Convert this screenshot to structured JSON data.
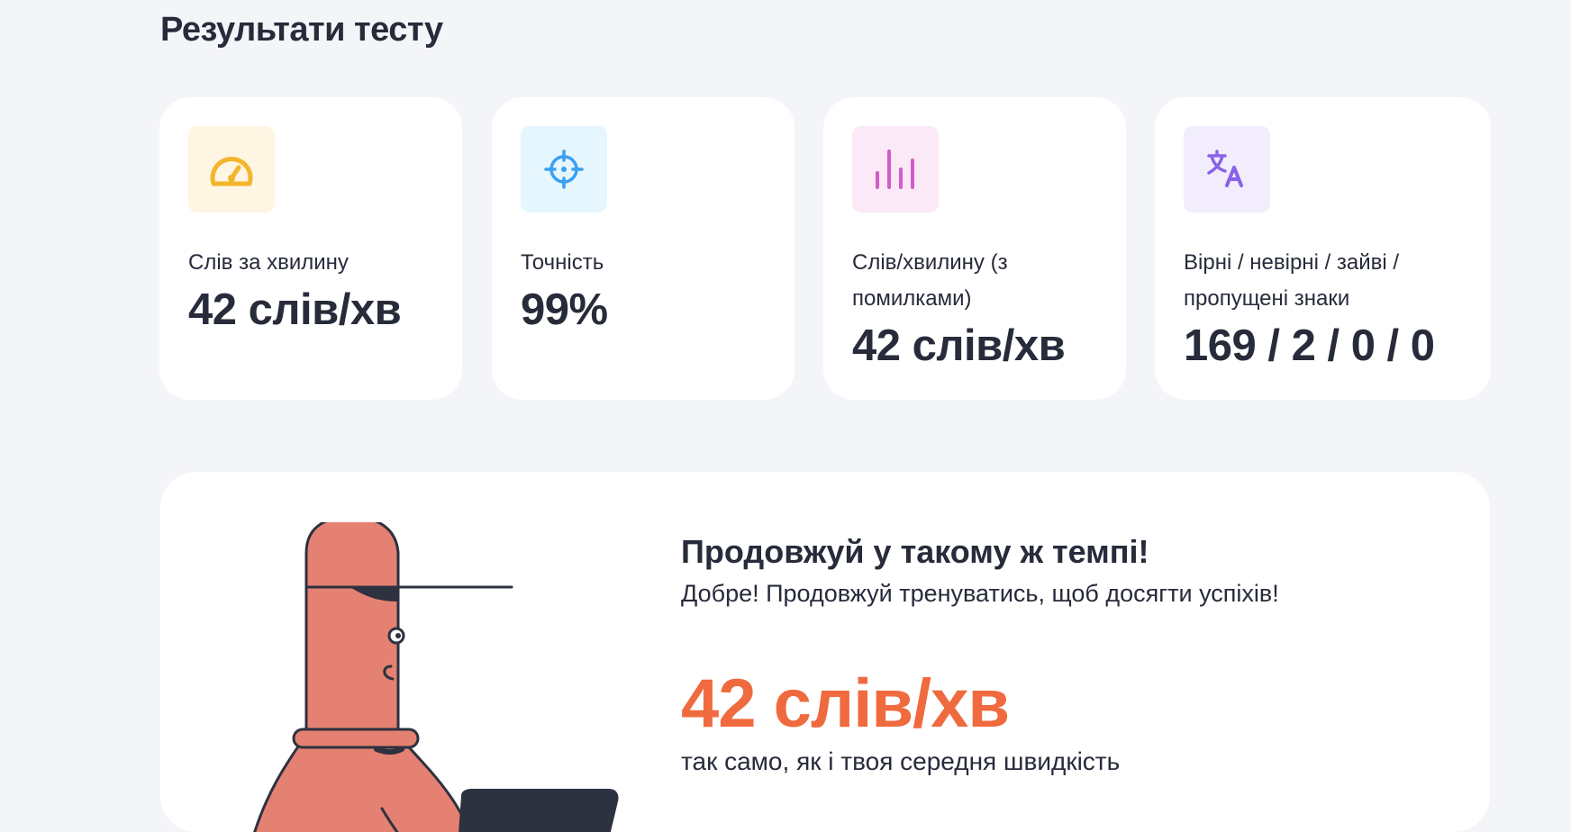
{
  "page": {
    "title": "Результати тесту"
  },
  "cards": [
    {
      "label": "Слів за хвилину",
      "value": "42 слів/хв",
      "icon": "speedometer-icon",
      "icon_color": "#f3b52a",
      "icon_bg": "#fff5e3"
    },
    {
      "label": "Точність",
      "value": "99%",
      "icon": "crosshair-icon",
      "icon_color": "#3aa0f0",
      "icon_bg": "#e6f6fe"
    },
    {
      "label": "Слів/хвилину (з помилками)",
      "value": "42 слів/хв",
      "icon": "bar-chart-icon",
      "icon_color": "#d45cc9",
      "icon_bg": "#fbe9f7"
    },
    {
      "label": "Вірні / невірні / зайві / пропущені знаки",
      "value": "169 / 2 / 0 / 0",
      "icon": "translate-icon",
      "icon_color": "#8a62e8",
      "icon_bg": "#f1edfd"
    }
  ],
  "feedback": {
    "title": "Продовжуй у такому ж темпі!",
    "subtitle": "Добре! Продовжуй тренуватись, щоб досягти успіхів!",
    "speed": "42 слів/хв",
    "comparison": "так само, як і твоя середня швидкість",
    "accent_color": "#ef6a3e"
  }
}
